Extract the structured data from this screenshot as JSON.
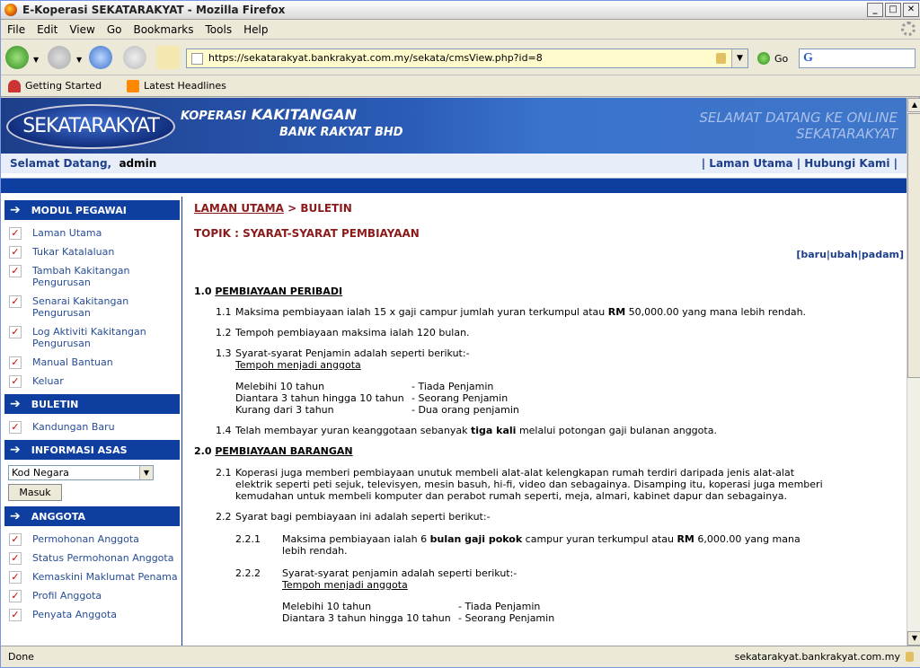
{
  "window": {
    "title": "E-Koperasi SEKATARAKYAT - Mozilla Firefox"
  },
  "menu": [
    "File",
    "Edit",
    "View",
    "Go",
    "Bookmarks",
    "Tools",
    "Help"
  ],
  "nav": {
    "url": "https://sekatarakyat.bankrakyat.com.my/sekata/cmsView.php?id=8",
    "go_label": "Go"
  },
  "bookmarks": [
    "Getting Started",
    "Latest Headlines"
  ],
  "header": {
    "logo": "SEKATARAKYAT",
    "koperasi": "KOPERASI",
    "kakitangan": "KAKITANGAN",
    "bank": "BANK RAKYAT BHD",
    "welcome_line1": "SELAMAT DATANG KE ONLINE",
    "welcome_line2": "SEKATARAKYAT"
  },
  "strip": {
    "greeting": "Selamat Datang,",
    "user": "admin",
    "links": "| Laman Utama | Hubungi Kami |"
  },
  "sidebar": {
    "modul_title": "MODUL PEGAWAI",
    "modul_items": [
      "Laman Utama",
      "Tukar Katalaluan",
      "Tambah Kakitangan Pengurusan",
      "Senarai Kakitangan Pengurusan",
      "Log Aktiviti Kakitangan Pengurusan",
      "Manual Bantuan",
      "Keluar"
    ],
    "buletin_title": "BULETIN",
    "buletin_items": [
      "Kandungan Baru"
    ],
    "info_title": "INFORMASI ASAS",
    "select_value": "Kod Negara",
    "submit_label": "Masuk",
    "anggota_title": "ANGGOTA",
    "anggota_items": [
      "Permohonan Anggota",
      "Status Permohonan Anggota",
      "Kemaskini Maklumat Penama",
      "Profil Anggota",
      "Penyata Anggota"
    ]
  },
  "main": {
    "crumb_link": "LAMAN UTAMA",
    "crumb_rest": "> BULETIN",
    "topik": "TOPIK : SYARAT-SYARAT PEMBIAYAAN",
    "actions": "[baru|ubah|padam]",
    "s1_num": "1.0",
    "s1_title": "PEMBIAYAAN PERIBADI",
    "p11_num": "1.1",
    "p11_a": "Maksima pembiayaan ialah 15 x gaji campur jumlah yuran terkumpul atau ",
    "p11_b": "RM",
    "p11_c": " 50,000.00 yang mana lebih rendah.",
    "p12_num": "1.2",
    "p12": "Tempoh pembiayaan maksima ialah 120 bulan.",
    "p13_num": "1.3",
    "p13": "Syarat-syarat Penjamin adalah seperti berikut:-",
    "tempoh": "Tempoh menjadi anggota",
    "t1a": "Melebihi 10 tahun",
    "t1b": "- Tiada Penjamin",
    "t2a": "Diantara 3 tahun hingga 10 tahun",
    "t2b": "- Seorang Penjamin",
    "t3a": "Kurang dari 3 tahun",
    "t3b": "- Dua orang penjamin",
    "p14_num": "1.4",
    "p14_a": "Telah membayar yuran keanggotaan sebanyak ",
    "p14_b": "tiga kali",
    "p14_c": " melalui potongan gaji bulanan anggota.",
    "s2_num": "2.0",
    "s2_title": "PEMBIAYAAN BARANGAN",
    "p21_num": "2.1",
    "p21": "Koperasi juga memberi pembiayaan unutuk membeli alat-alat kelengkapan rumah terdiri daripada jenis alat-alat elektrik seperti peti sejuk, televisyen, mesin basuh, hi-fi, video dan sebagainya. Disamping itu, koperasi juga memberi kemudahan untuk membeli komputer dan perabot rumah seperti, meja, almari, kabinet dapur dan sebagainya.",
    "p22_num": "2.2",
    "p22": "Syarat bagi pembiayaan ini adalah seperti berikut:-",
    "p221_num": "2.2.1",
    "p221_a": "Maksima pembiayaan ialah 6 ",
    "p221_b": "bulan gaji pokok",
    "p221_c": " campur yuran terkumpul atau ",
    "p221_d": "RM",
    "p221_e": " 6,000.00 yang mana lebih rendah.",
    "p222_num": "2.2.2",
    "p222": "Syarat-syarat penjamin adalah seperti berikut:-",
    "tempoh2": "Tempoh menjadi anggota",
    "u1a": "Melebihi 10 tahun",
    "u1b": "- Tiada Penjamin",
    "u2a": "Diantara 3 tahun hingga 10 tahun",
    "u2b": "- Seorang Penjamin"
  },
  "status": {
    "left": "Done",
    "right": "sekatarakyat.bankrakyat.com.my"
  }
}
